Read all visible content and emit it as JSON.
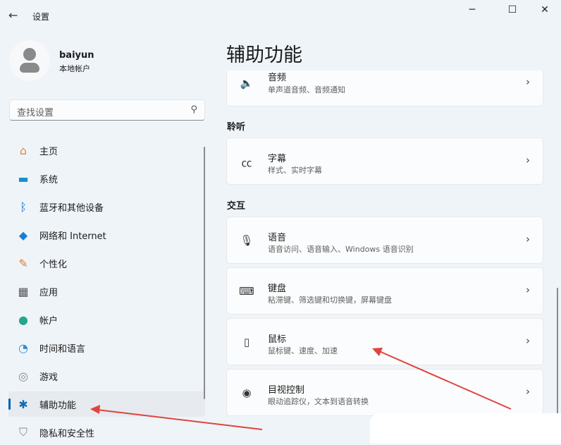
{
  "window": {
    "title": "设置",
    "minimize": "─",
    "maximize": "☐",
    "close": "✕"
  },
  "user": {
    "name": "baiyun",
    "type": "本地帐户"
  },
  "search": {
    "placeholder": "查找设置"
  },
  "sidebar": {
    "items": [
      {
        "label": "主页",
        "icon": "home-icon"
      },
      {
        "label": "系统",
        "icon": "system-icon"
      },
      {
        "label": "蓝牙和其他设备",
        "icon": "bluetooth-icon"
      },
      {
        "label": "网络和 Internet",
        "icon": "wifi-icon"
      },
      {
        "label": "个性化",
        "icon": "brush-icon"
      },
      {
        "label": "应用",
        "icon": "apps-icon"
      },
      {
        "label": "帐户",
        "icon": "account-icon"
      },
      {
        "label": "时间和语言",
        "icon": "clock-icon"
      },
      {
        "label": "游戏",
        "icon": "gamepad-icon"
      },
      {
        "label": "辅助功能",
        "icon": "accessibility-icon",
        "selected": true
      },
      {
        "label": "隐私和安全性",
        "icon": "shield-icon"
      }
    ]
  },
  "main": {
    "title": "辅助功能",
    "audio": {
      "title": "音频",
      "subtitle": "单声道音频、音频通知"
    },
    "sections": [
      {
        "header": "聆听",
        "items": [
          {
            "title": "字幕",
            "subtitle": "样式、实时字幕"
          }
        ]
      },
      {
        "header": "交互",
        "items": [
          {
            "title": "语音",
            "subtitle": "语音访问、语音输入、Windows 语音识别"
          },
          {
            "title": "键盘",
            "subtitle": "粘滞键、筛选键和切换键，屏幕键盘"
          },
          {
            "title": "鼠标",
            "subtitle": "鼠标键、速度、加速"
          },
          {
            "title": "目视控制",
            "subtitle": "眼动追踪仪，文本到语音转换"
          }
        ]
      }
    ]
  },
  "colors": {
    "accent": "#005fb8",
    "annotation": "#e0443c"
  }
}
